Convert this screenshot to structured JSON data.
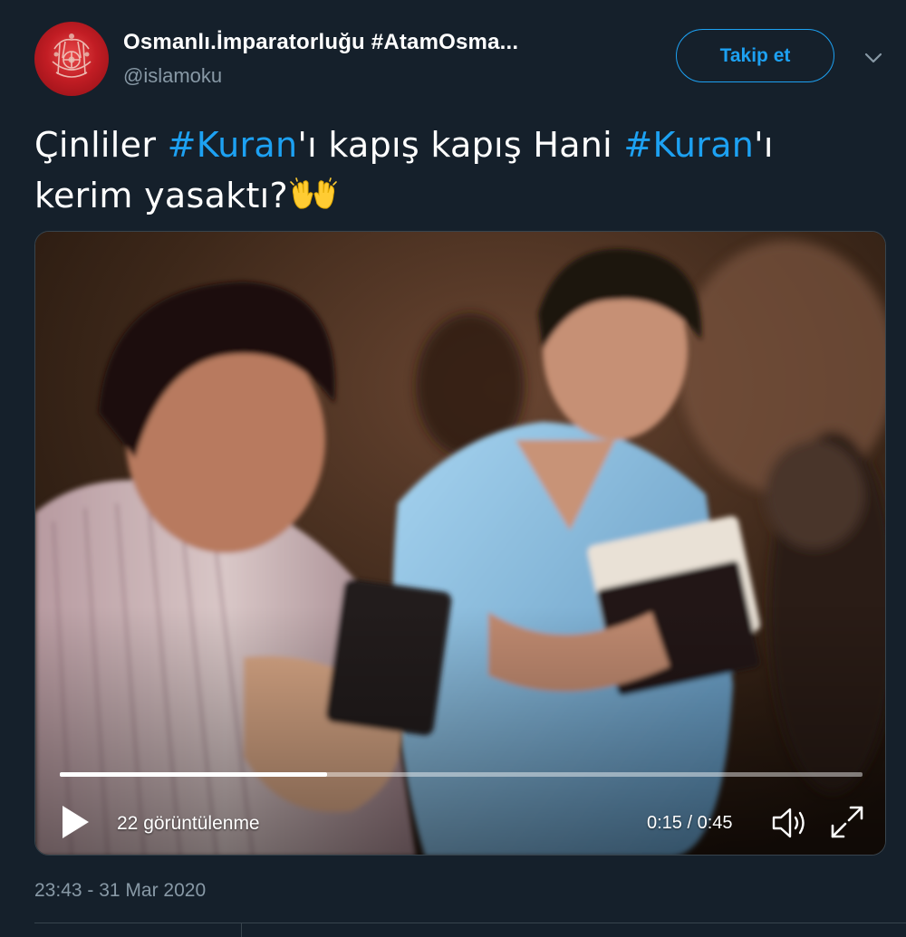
{
  "author": {
    "display_name": "Osmanlı.İmparatorluğu #AtamOsma...",
    "handle": "@islamoku",
    "avatar_icon": "ottoman-coat-of-arms-icon"
  },
  "follow_button": {
    "label": "Takip et"
  },
  "menu": {
    "icon": "chevron-down-icon"
  },
  "tweet": {
    "segments": [
      {
        "text": "Çinliler ",
        "hashtag": false
      },
      {
        "text": "#Kuran",
        "hashtag": true
      },
      {
        "text": "'ı kapış kapış Hani ",
        "hashtag": false
      },
      {
        "text": "#Kuran",
        "hashtag": true
      },
      {
        "text": "'ı kerim yasaktı?",
        "hashtag": false
      }
    ],
    "emoji": "raising-hands-emoji"
  },
  "video": {
    "progress": 0.333,
    "views": "22 görüntülenme",
    "time": "0:15 / 0:45",
    "icons": [
      "play-icon",
      "volume-icon",
      "fullscreen-icon"
    ]
  },
  "timestamp": "23:43 - 31 Mar 2020",
  "colors": {
    "background": "#15202b",
    "accent": "#1da1f2",
    "secondary_text": "#8899a6",
    "border": "#38444d"
  }
}
